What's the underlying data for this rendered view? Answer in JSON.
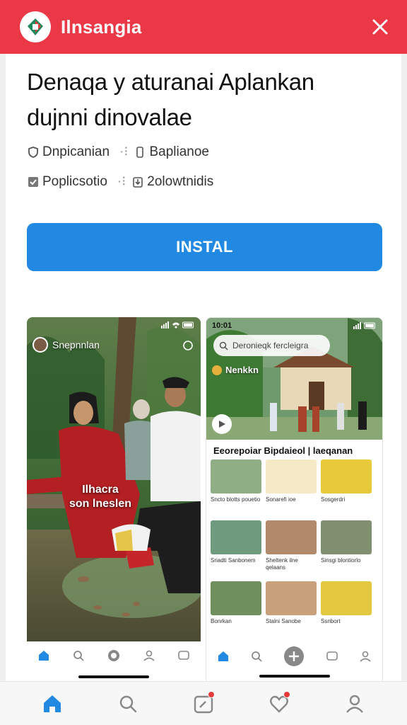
{
  "header": {
    "app_name": "Ilnsangia",
    "accent_color": "#ea3847"
  },
  "app": {
    "title_line1": "Denaqa y aturanai Aplankan",
    "title_line2": "dujnni dinovalae",
    "meta": [
      {
        "icon": "shield-icon",
        "label": "Dnpicanian"
      },
      {
        "icon": "phone-icon",
        "label": "Baplianoe"
      },
      {
        "icon": "check-icon",
        "label": "Poplicsotio"
      },
      {
        "icon": "download-icon",
        "label": "2olowtnidis"
      }
    ],
    "install_label": "INSTAL",
    "install_color": "#2289e3"
  },
  "screenshots": {
    "shot1": {
      "time": "",
      "profile_name": "Snepnnlan",
      "caption_line1": "Ilhacra",
      "caption_line2": "son lneslen"
    },
    "shot2": {
      "time": "10:01",
      "search_placeholder": "Deronieqk fercleigra",
      "label": "Nenkkn",
      "section_title": "Eeorepoiar Bipdaieol | laeqanan",
      "tiles": [
        {
          "caption": "Sncto blotts pouetio"
        },
        {
          "caption": "Sonarefi ioe"
        },
        {
          "caption": "Sosgerdri"
        },
        {
          "caption": "Sriadti Sanbonem"
        },
        {
          "caption": "Sheltenk ilne qelaans"
        },
        {
          "caption": "Sinsgi blontiorlo"
        },
        {
          "caption": "Bonrkan"
        },
        {
          "caption": "Stalni Sanobe"
        },
        {
          "caption": "Ssnbort"
        }
      ]
    }
  },
  "bottom_nav": {
    "items": [
      "home-icon",
      "search-icon",
      "calendar-icon",
      "heart-icon",
      "user-icon"
    ]
  }
}
